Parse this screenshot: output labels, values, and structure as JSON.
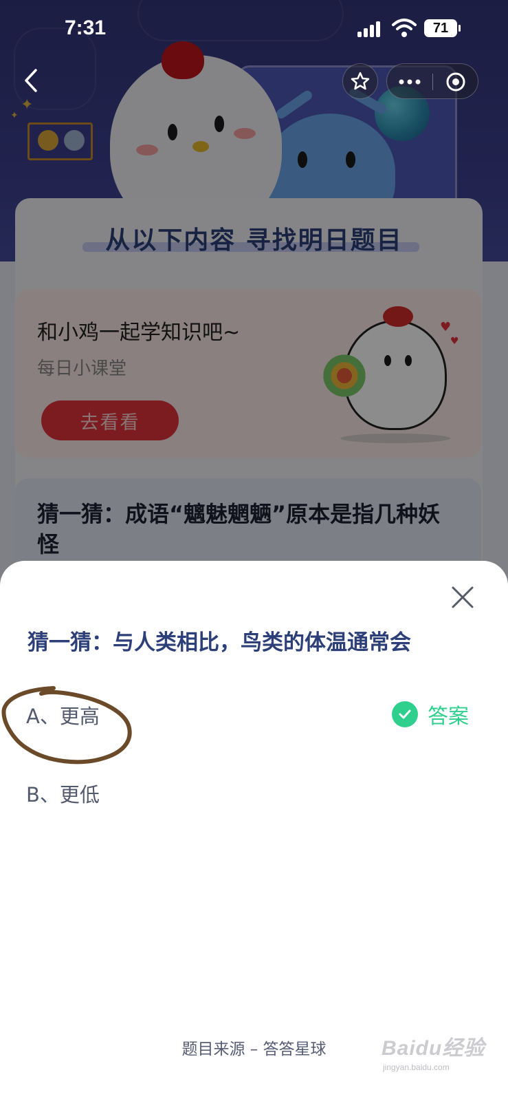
{
  "status_bar": {
    "time": "7:31",
    "battery": "71"
  },
  "nav": {
    "back_icon": "chevron-left-icon",
    "favorite_icon": "star-icon",
    "more_icon": "more-dots-icon",
    "close_icon": "target-circle-icon"
  },
  "background": {
    "section_title": "从以下内容  寻找明日题目",
    "promo": {
      "title": "和小鸡一起学知识吧~",
      "subtitle": "每日小课堂",
      "button_label": "去看看"
    },
    "riddle": {
      "text": "猜一猜：成语“魑魅魍魉”原本是指几种妖怪"
    }
  },
  "sheet": {
    "question": "猜一猜：与人类相比，鸟类的体温通常会",
    "options": [
      {
        "label": "A、更高",
        "is_answer": true
      },
      {
        "label": "B、更低",
        "is_answer": false
      }
    ],
    "answer_label": "答案",
    "source": "题目来源 – 答答星球",
    "colors": {
      "question": "#2c3f78",
      "answer": "#2fcf8e",
      "annotation": "#6b4a2a"
    }
  },
  "watermark": {
    "logo": "Baidu经验",
    "sub": "jingyan.baidu.com"
  }
}
